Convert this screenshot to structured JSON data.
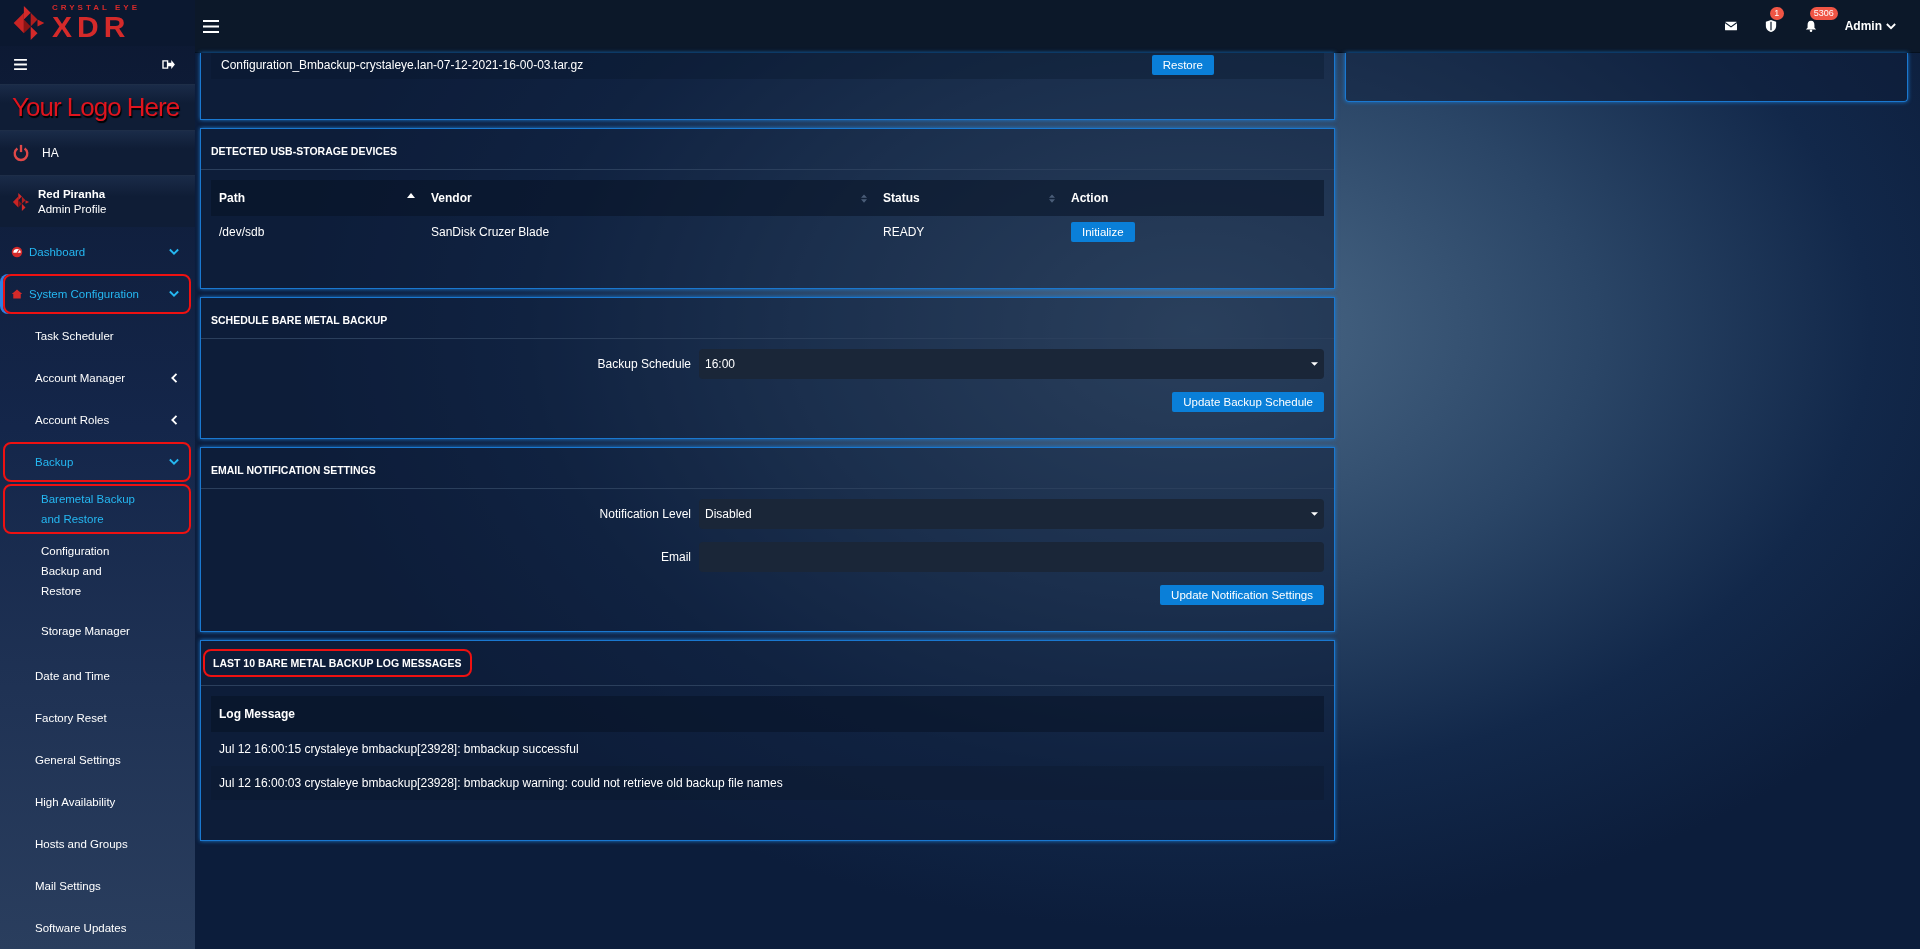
{
  "brand": {
    "tagline": "CRYSTAL EYE",
    "name": "XDR"
  },
  "sidebar": {
    "custom_logo": "Your Logo Here",
    "ha_label": "HA",
    "profile": {
      "name": "Red Piranha",
      "role": "Admin Profile"
    },
    "items": [
      {
        "label": "Dashboard",
        "kind": "gauge",
        "expanded": true,
        "selected": false,
        "highlighted": false
      },
      {
        "label": "System Configuration",
        "kind": "house",
        "expanded": true,
        "selected": true,
        "highlighted": true,
        "children": [
          {
            "label": "Task Scheduler",
            "selected": false,
            "highlighted": false
          },
          {
            "label": "Account Manager",
            "expanded": false,
            "selected": false,
            "highlighted": false
          },
          {
            "label": "Account Roles",
            "expanded": false,
            "selected": false,
            "highlighted": false
          },
          {
            "label": "Backup",
            "expanded": true,
            "selected": true,
            "highlighted": true,
            "children": [
              {
                "label": "Baremetal Backup and Restore",
                "selected": true,
                "highlighted": true
              },
              {
                "label": "Configuration Backup and Restore",
                "selected": false,
                "highlighted": false
              },
              {
                "label": "Storage Manager",
                "selected": false,
                "highlighted": false
              }
            ]
          },
          {
            "label": "Date and Time",
            "selected": false,
            "highlighted": false
          },
          {
            "label": "Factory Reset",
            "selected": false,
            "highlighted": false
          },
          {
            "label": "General Settings",
            "selected": false,
            "highlighted": false
          },
          {
            "label": "High Availability",
            "selected": false,
            "highlighted": false
          },
          {
            "label": "Hosts and Groups",
            "selected": false,
            "highlighted": false
          },
          {
            "label": "Mail Settings",
            "selected": false,
            "highlighted": false
          },
          {
            "label": "Software Updates",
            "selected": false,
            "highlighted": false
          }
        ]
      }
    ]
  },
  "topbar": {
    "indicators": [
      {
        "kind": "mail"
      },
      {
        "kind": "shield",
        "count": "1"
      },
      {
        "kind": "bell",
        "count": "5306"
      }
    ],
    "user": "Admin"
  },
  "backup_files": {
    "rows": [
      {
        "file": "Configuration_Bmbackup-crystaleye.lan-07-12-2021-16-00-03.tar.gz",
        "action": "Restore"
      }
    ]
  },
  "usb_devices": {
    "title": "DETECTED USB-STORAGE DEVICES",
    "columns": [
      {
        "label": "Path",
        "sorted": true
      },
      {
        "label": "Vendor",
        "sorted": false
      },
      {
        "label": "Status",
        "sorted": false
      },
      {
        "label": "Action"
      }
    ],
    "rows": [
      {
        "path": "/dev/sdb",
        "vendor": "SanDisk Cruzer Blade",
        "status": "READY",
        "action": "Initialize"
      }
    ]
  },
  "schedule": {
    "title": "SCHEDULE BARE METAL BACKUP",
    "fields": [
      {
        "kind": "select",
        "label": "Backup Schedule",
        "value": "16:00"
      }
    ],
    "button": "Update Backup Schedule"
  },
  "email": {
    "title": "EMAIL NOTIFICATION SETTINGS",
    "fields": [
      {
        "kind": "select",
        "label": "Notification Level",
        "value": "Disabled"
      },
      {
        "kind": "text",
        "label": "Email"
      }
    ],
    "button": "Update Notification Settings"
  },
  "log": {
    "title": "LAST 10 BARE METAL BACKUP LOG MESSAGES",
    "highlighted": true,
    "column": "Log Message",
    "rows": [
      "Jul 12 16:00:15 crystaleye bmbackup[23928]: bmbackup successful",
      "Jul 12 16:00:03 crystaleye bmbackup[23928]: bmbackup warning: could not retrieve old backup file names"
    ]
  }
}
